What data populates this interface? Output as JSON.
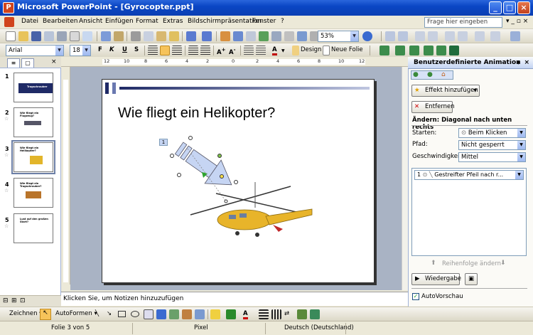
{
  "window": {
    "title": "Microsoft PowerPoint - [Gyrocopter.ppt]",
    "app_icon_letter": "P",
    "min_label": "_",
    "max_label": "□",
    "close_label": "×"
  },
  "menu": {
    "items": [
      "Datei",
      "Bearbeiten",
      "Ansicht",
      "Einfügen",
      "Format",
      "Extras",
      "Bildschirmpräsentation",
      "Fenster",
      "?"
    ],
    "help_placeholder": "Frage hier eingeben"
  },
  "toolbar": {
    "zoom": "53%",
    "font": "Arial",
    "font_size": "18",
    "bold": "F",
    "italic": "K",
    "underline": "U",
    "shadow": "S",
    "design_label": "Design",
    "new_slide_label": "Neue Folie"
  },
  "left_pane": {
    "thumbnails": [
      {
        "num": "1",
        "title": "Tragschrauber"
      },
      {
        "num": "2",
        "title": "Wie fliegt ein Flugzeug?"
      },
      {
        "num": "3",
        "title": "Wie fliegt ein Helikopter?"
      },
      {
        "num": "4",
        "title": "Wie fliegt ein Tragschrauber?"
      },
      {
        "num": "5",
        "title": "Lust auf den großen Start?"
      }
    ]
  },
  "ruler": {
    "ticks": [
      "12",
      "10",
      "8",
      "6",
      "4",
      "2",
      "0",
      "2",
      "4",
      "6",
      "8",
      "10",
      "12"
    ]
  },
  "slide": {
    "title": "Wie fliegt ein Helikopter?",
    "anim_tag": "1"
  },
  "notes": {
    "placeholder": "Klicken Sie, um Notizen hinzuzufügen"
  },
  "task_pane": {
    "title": "Benutzerdefinierte Animation",
    "add_effect": "Effekt hinzufügen",
    "remove": "Entfernen",
    "change_label": "Ändern: Diagonal nach unten rechts",
    "start_label": "Starten:",
    "start_value": "Beim Klicken",
    "path_label": "Pfad:",
    "path_value": "Nicht gesperrt",
    "speed_label": "Geschwindigkeit:",
    "speed_value": "Mittel",
    "anim_item_num": "1",
    "anim_item_text": "Gestreifter Pfeil nach r...",
    "reorder": "Reihenfolge ändern",
    "play": "Wiedergabe",
    "autopreview": "AutoVorschau"
  },
  "drawbar": {
    "draw_label": "Zeichnen",
    "autoshapes_label": "AutoFormen"
  },
  "status": {
    "slide": "Folie 3 von 5",
    "design": "Pixel",
    "language": "Deutsch (Deutschland)"
  },
  "colors": {
    "title_bar": "#0a46c4",
    "slide_bg": "#ffffff",
    "workspace_bg": "#a9b3c4"
  }
}
